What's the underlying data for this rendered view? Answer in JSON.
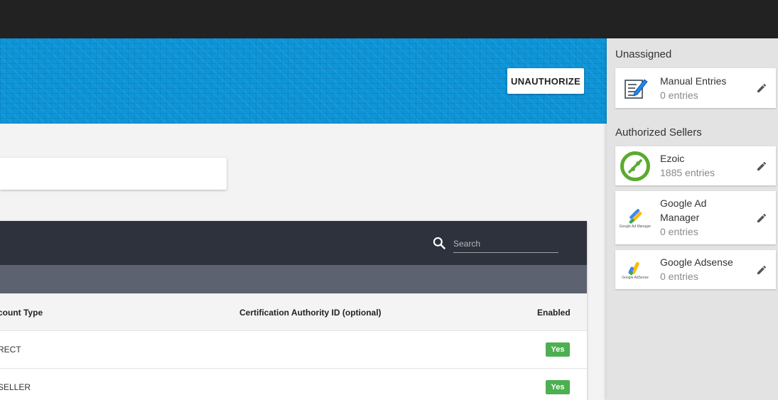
{
  "hero": {
    "unauthorize_label": "UNAUTHORIZE"
  },
  "table": {
    "search_placeholder": "Search",
    "columns": [
      "count Type",
      "Certification Authority ID (optional)",
      "Enabled"
    ],
    "rows": [
      {
        "account_type": "RECT",
        "cert_id": "",
        "enabled": "Yes"
      },
      {
        "account_type": "SELLER",
        "cert_id": "",
        "enabled": "Yes"
      }
    ]
  },
  "sidebar": {
    "unassigned_title": "Unassigned",
    "authorized_title": "Authorized Sellers",
    "unassigned": [
      {
        "name": "Manual Entries",
        "count": "0 entries",
        "icon": "manual-entries-icon"
      }
    ],
    "authorized": [
      {
        "name": "Ezoic",
        "count": "1885 entries",
        "icon": "ezoic-logo"
      },
      {
        "name_line1": "Google Ad",
        "name_line2": "Manager",
        "count": "0 entries",
        "icon": "google-ad-manager-logo",
        "logo_caption": "Google Ad Manager"
      },
      {
        "name": "Google Adsense",
        "count": "0 entries",
        "icon": "google-adsense-logo",
        "logo_caption": "Google AdSense"
      }
    ]
  },
  "colors": {
    "topbar": "#222222",
    "hero_blue": "#0e95d8",
    "table_header": "#2e323c",
    "table_subheader": "#5d6270",
    "enabled_badge": "#4caf50",
    "ezoic_green": "#5aab2e"
  }
}
